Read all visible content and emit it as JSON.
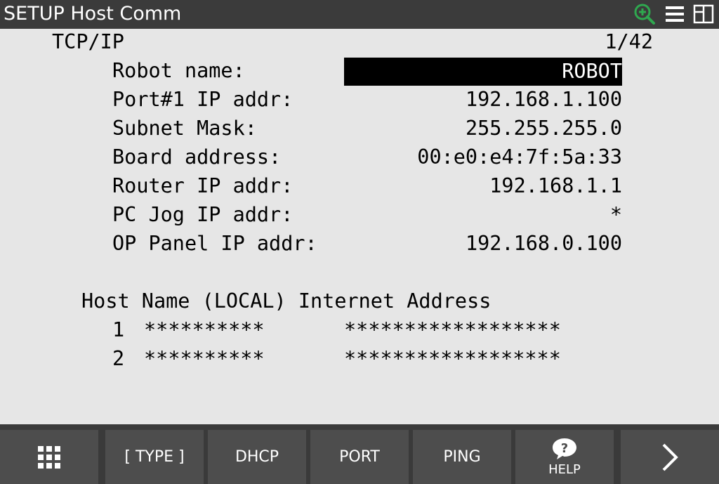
{
  "title": "SETUP Host Comm",
  "icons": {
    "zoom": "zoom-in-icon",
    "menu": "menu-icon",
    "layout": "split-window-icon",
    "accent_green": "#2fa84f"
  },
  "header": {
    "section": "TCP/IP",
    "page": "1/42"
  },
  "fields": [
    {
      "label": "Robot name:",
      "value": "ROBOT"
    },
    {
      "label": "Port#1 IP addr:",
      "value": "192.168.1.100"
    },
    {
      "label": "Subnet Mask:",
      "value": "255.255.255.0"
    },
    {
      "label": "Board address:",
      "value": "00:e0:e4:7f:5a:33"
    },
    {
      "label": "Router IP addr:",
      "value": "192.168.1.1"
    },
    {
      "label": "PC Jog IP addr:",
      "value": "*"
    },
    {
      "label": "OP Panel IP addr:",
      "value": "192.168.0.100"
    }
  ],
  "host_table": {
    "header": "Host Name (LOCAL) Internet Address",
    "rows": [
      {
        "num": "1",
        "name": "**********",
        "address": "******************"
      },
      {
        "num": "2",
        "name": "**********",
        "address": "******************"
      }
    ]
  },
  "function_keys": [
    {
      "label": "",
      "icon": "grid-menu-icon"
    },
    {
      "label": "[ TYPE ]"
    },
    {
      "label": "DHCP"
    },
    {
      "label": "PORT"
    },
    {
      "label": "PING"
    },
    {
      "label": "HELP",
      "icon": "help-icon"
    },
    {
      "label": "",
      "icon": "chevron-right-icon"
    }
  ]
}
